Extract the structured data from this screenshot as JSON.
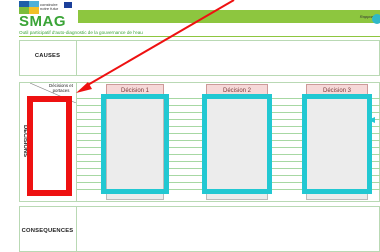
{
  "header": {
    "logo_text": "construire\nnotre futur",
    "brand": "SMAG",
    "tagline": "Outil participatif d'auto-diagnostic de la gouvernance de l'eau",
    "bar_text": "Rapport"
  },
  "sections": {
    "causes_label": "CAUSES",
    "decisions_label": "DECISIONS",
    "decisions_corner": "Décisions et portaces",
    "consequences_label": "CONSEQUENCES"
  },
  "decisions": [
    {
      "label": "Décision 1"
    },
    {
      "label": "Décision 2"
    },
    {
      "label": "Décision 3"
    }
  ],
  "annotation_colors": {
    "highlight_red": "#ee1111",
    "highlight_cyan": "#22c8d2",
    "arrow_red": "#ee1111"
  }
}
